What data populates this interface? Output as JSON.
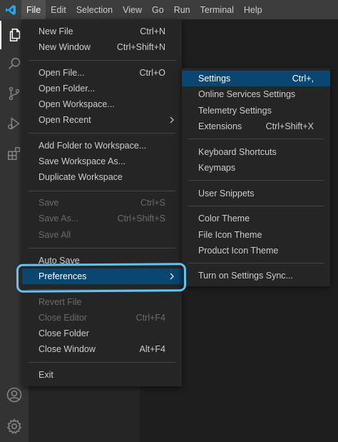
{
  "menubar": {
    "items": [
      "File",
      "Edit",
      "Selection",
      "View",
      "Go",
      "Run",
      "Terminal",
      "Help"
    ]
  },
  "activitybar": {
    "icons": [
      "explorer-icon",
      "search-icon",
      "source-control-icon",
      "run-debug-icon",
      "extensions-icon",
      "accounts-icon",
      "manage-gear-icon"
    ]
  },
  "file_menu": {
    "new_file": {
      "label": "New File",
      "kb": "Ctrl+N"
    },
    "new_window": {
      "label": "New Window",
      "kb": "Ctrl+Shift+N"
    },
    "open_file": {
      "label": "Open File...",
      "kb": "Ctrl+O"
    },
    "open_folder": {
      "label": "Open Folder..."
    },
    "open_workspace": {
      "label": "Open Workspace..."
    },
    "open_recent": {
      "label": "Open Recent"
    },
    "add_folder": {
      "label": "Add Folder to Workspace..."
    },
    "save_workspace_as": {
      "label": "Save Workspace As..."
    },
    "duplicate_workspace": {
      "label": "Duplicate Workspace"
    },
    "save": {
      "label": "Save",
      "kb": "Ctrl+S"
    },
    "save_as": {
      "label": "Save As...",
      "kb": "Ctrl+Shift+S"
    },
    "save_all": {
      "label": "Save All"
    },
    "auto_save": {
      "label": "Auto Save"
    },
    "preferences": {
      "label": "Preferences"
    },
    "revert_file": {
      "label": "Revert File"
    },
    "close_editor": {
      "label": "Close Editor",
      "kb": "Ctrl+F4"
    },
    "close_folder": {
      "label": "Close Folder"
    },
    "close_window": {
      "label": "Close Window",
      "kb": "Alt+F4"
    },
    "exit": {
      "label": "Exit"
    }
  },
  "pref_menu": {
    "settings": {
      "label": "Settings",
      "kb": "Ctrl+,"
    },
    "online_services": {
      "label": "Online Services Settings"
    },
    "telemetry": {
      "label": "Telemetry Settings"
    },
    "extensions": {
      "label": "Extensions",
      "kb": "Ctrl+Shift+X"
    },
    "keyboard_shortcuts": {
      "label": "Keyboard Shortcuts"
    },
    "keymaps": {
      "label": "Keymaps"
    },
    "user_snippets": {
      "label": "User Snippets"
    },
    "color_theme": {
      "label": "Color Theme"
    },
    "file_icon_theme": {
      "label": "File Icon Theme"
    },
    "product_icon_theme": {
      "label": "Product Icon Theme"
    },
    "settings_sync": {
      "label": "Turn on Settings Sync..."
    }
  },
  "colors": {
    "menubar_bg": "#3c3c3c",
    "activitybar_bg": "#333333",
    "sidebar_bg": "#252526",
    "editor_bg": "#1e1e1e",
    "selection_bg": "#094771",
    "highlight_stroke": "#62c4f4",
    "vscode_blue": "#23a9f2"
  }
}
